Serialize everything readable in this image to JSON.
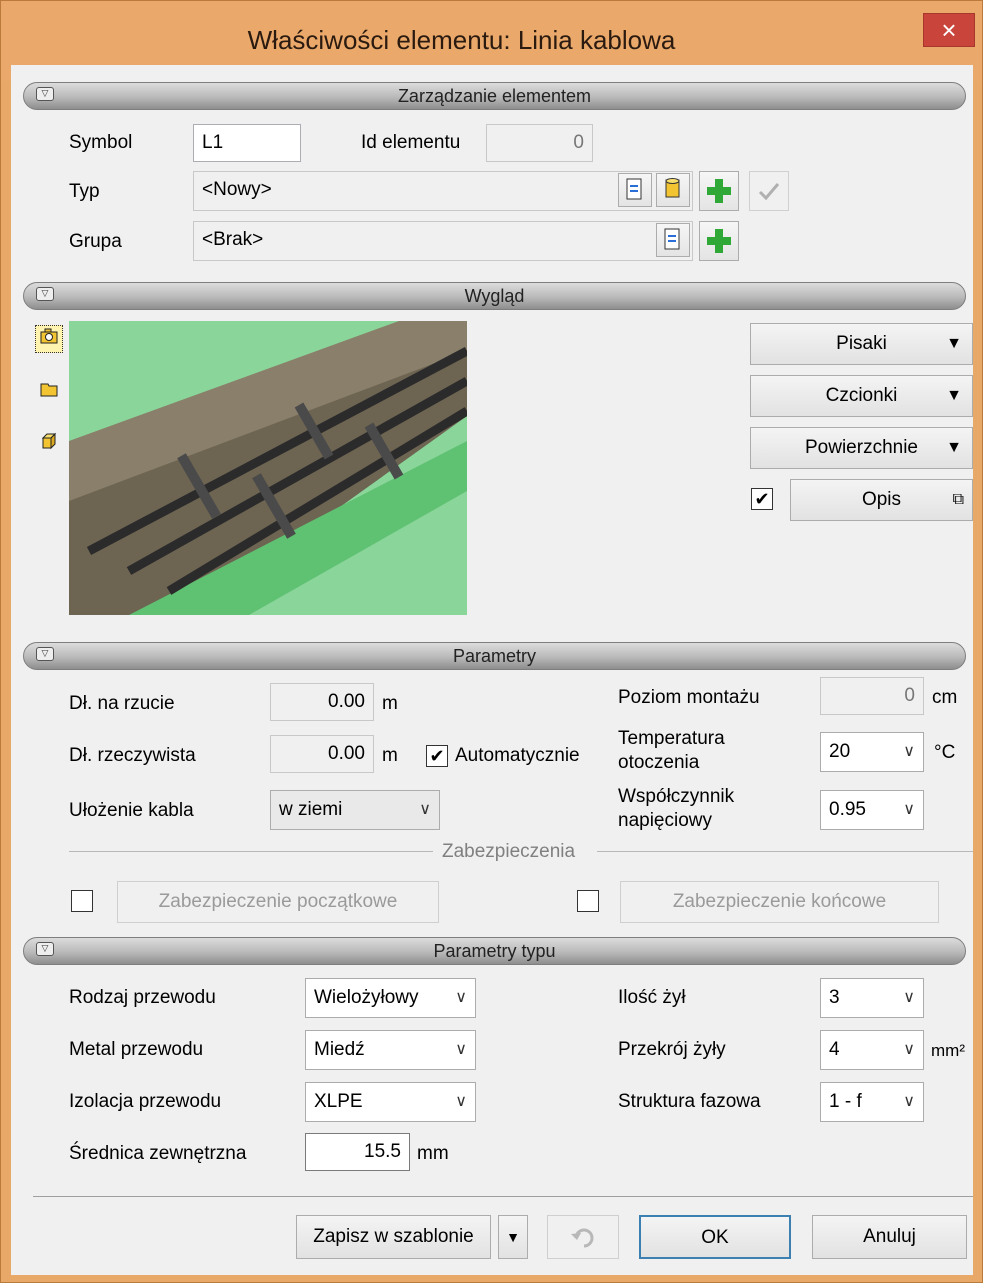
{
  "window": {
    "title": "Właściwości elementu: Linia kablowa",
    "close_glyph": "×"
  },
  "sections": {
    "management": "Zarządzanie elementem",
    "appearance": "Wygląd",
    "params": "Parametry",
    "type_params": "Parametry typu"
  },
  "management": {
    "symbol_label": "Symbol",
    "symbol_value": "L1",
    "id_label": "Id elementu",
    "id_value": "0",
    "type_label": "Typ",
    "type_value": "<Nowy>",
    "group_label": "Grupa",
    "group_value": "<Brak>"
  },
  "appearance": {
    "pens": "Pisaki",
    "fonts": "Czcionki",
    "surfaces": "Powierzchnie",
    "description": "Opis",
    "description_checked": true
  },
  "params": {
    "plan_len_label": "Dł. na rzucie",
    "plan_len_value": "0.00",
    "plan_len_unit": "m",
    "real_len_label": "Dł. rzeczywista",
    "real_len_value": "0.00",
    "real_len_unit": "m",
    "auto_label": "Automatycznie",
    "auto_checked": true,
    "laying_label": "Ułożenie kabla",
    "laying_value": "w ziemi",
    "mount_label": "Poziom montażu",
    "mount_value": "0",
    "mount_unit": "cm",
    "temp_label_1": "Temperatura",
    "temp_label_2": "otoczenia",
    "temp_value": "20",
    "temp_unit": "°C",
    "volt_label_1": "Współczynnik",
    "volt_label_2": "napięciowy",
    "volt_value": "0.95",
    "protection_group": "Zabezpieczenia",
    "start_protection": "Zabezpieczenie początkowe",
    "end_protection": "Zabezpieczenie końcowe"
  },
  "type_params": {
    "wire_kind_label": "Rodzaj przewodu",
    "wire_kind_value": "Wielożyłowy",
    "metal_label": "Metal przewodu",
    "metal_value": "Miedź",
    "insul_label": "Izolacja przewodu",
    "insul_value": "XLPE",
    "diam_label": "Średnica zewnętrzna",
    "diam_value": "15.5",
    "diam_unit": "mm",
    "cores_label": "Ilość żył",
    "cores_value": "3",
    "cross_label": "Przekrój żyły",
    "cross_value": "4",
    "cross_unit": "mm²",
    "phase_label": "Struktura fazowa",
    "phase_value": "1 - f"
  },
  "footer": {
    "save_template": "Zapisz w szablonie",
    "ok": "OK",
    "cancel": "Anuluj"
  },
  "colors": {
    "title_bg": "#eaa96a",
    "close_bg": "#c9443a",
    "ground_green": "#8ad59a"
  }
}
